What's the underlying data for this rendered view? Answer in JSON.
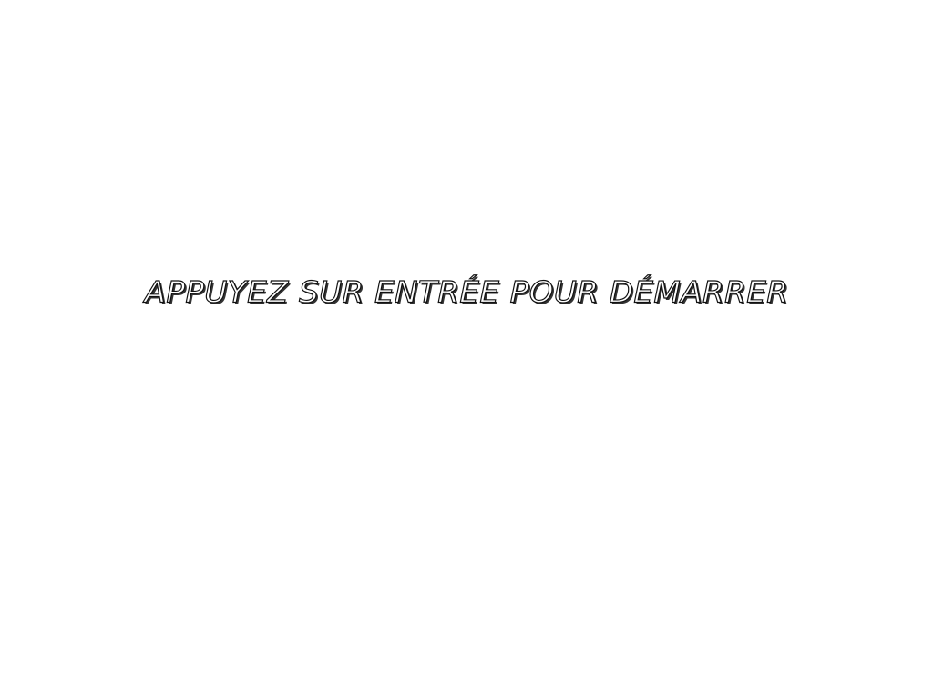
{
  "screen": {
    "background_color": "#ffffff",
    "prompt": {
      "text": "APPUYEZ SUR ENTRÉE POUR DÉMARRER",
      "fill_color": "#ffffff",
      "outline_color": "#111111"
    }
  }
}
